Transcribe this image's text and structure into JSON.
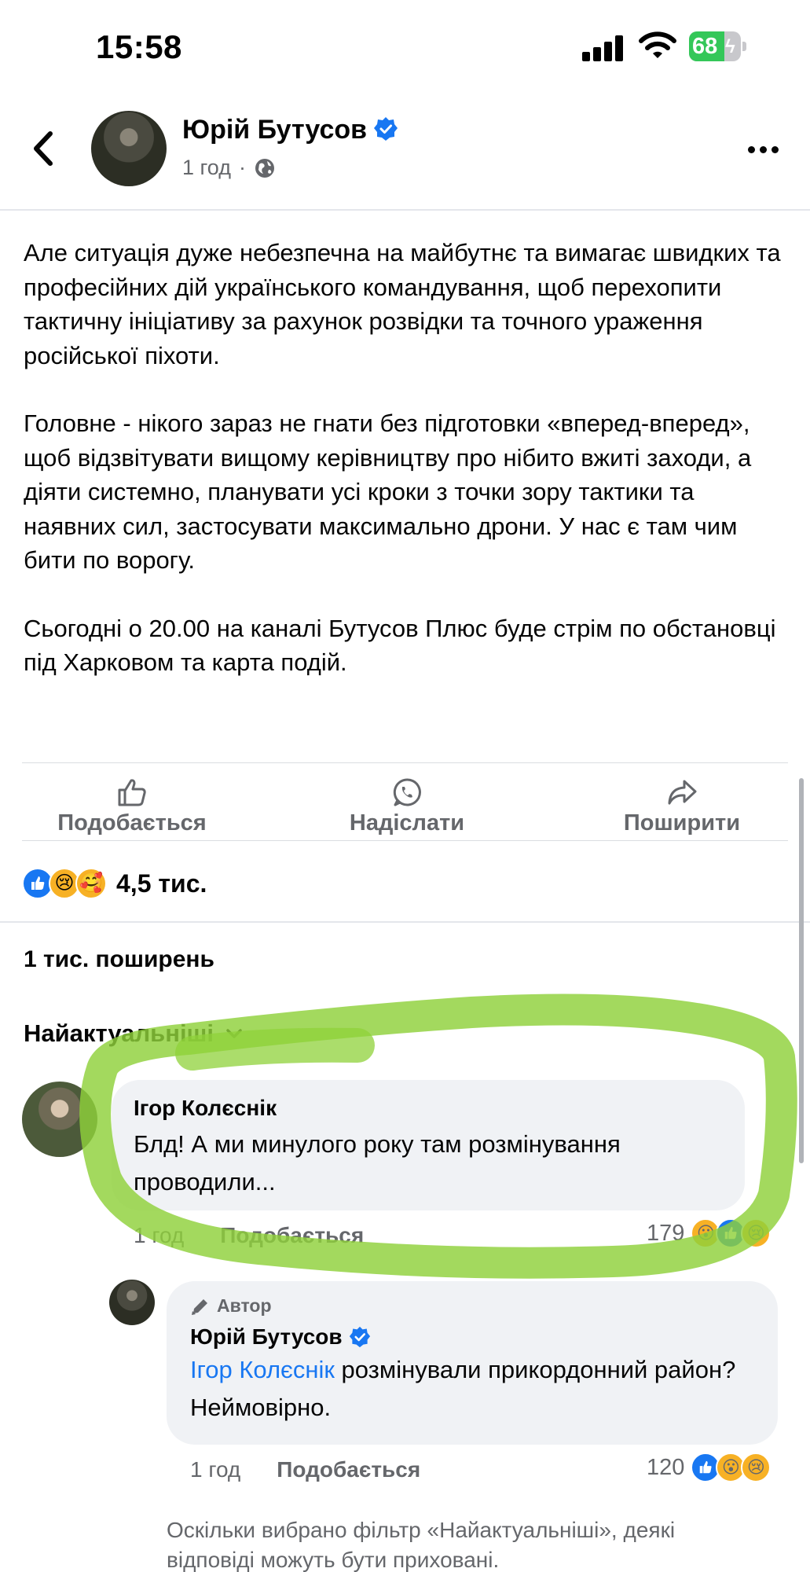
{
  "status_bar": {
    "time": "15:58",
    "battery": "68",
    "battery_level_percent": 68
  },
  "header": {
    "author": "Юрій Бутусов",
    "time": "1 год",
    "separator": "·"
  },
  "post": {
    "paragraphs": [
      "Але ситуація дуже небезпечна на майбутнє та вимагає швидких та професійних дій українського командування, щоб перехопити тактичну ініціативу за рахунок розвідки та точного ураження російської піхоти.",
      "Головне - нікого зараз не гнати без підготовки «вперед-вперед», щоб відзвітувати вищому керівництву про нібито вжиті заходи, а діяти системно, планувати усі кроки з точки зору тактики та наявних сил, застосувати максимально дрони. У нас є там чим бити по ворогу.",
      "Сьогодні о 20.00 на каналі Бутусов Плюс буде стрім по обстановці під Харковом та карта подій."
    ]
  },
  "actions": {
    "like": "Подобається",
    "send": "Надіслати",
    "share": "Поширити"
  },
  "reactions": {
    "count": "4,5 тис.",
    "icons": [
      "like",
      "sad",
      "care"
    ]
  },
  "shares": "1 тис. поширень",
  "sort": {
    "label": "Найактуальніші"
  },
  "comments": [
    {
      "author": "Ігор Колєснік",
      "text": "Блд! А ми минулого року там розмінування проводили...",
      "time": "1 год",
      "like_label": "Подобається",
      "reaction_count": "179",
      "reaction_icons": [
        "wow",
        "like",
        "sad"
      ]
    }
  ],
  "reply": {
    "badge": "Автор",
    "author": "Юрій Бутусов",
    "mention": "Ігор Колєснік",
    "text": " розмінували прикордонний район? Неймовірно.",
    "time": "1 год",
    "like_label": "Подобається",
    "reaction_count": "120",
    "reaction_icons": [
      "like",
      "wow",
      "sad"
    ]
  },
  "filter_note": "Оскільки вибрано фільтр «Найактуальніші», деякі відповіді можуть бути приховані.",
  "colors": {
    "brand": "#1877f2",
    "highlight": "#8fd13a",
    "battery": "#34c759",
    "secondary_text": "#65676b"
  }
}
